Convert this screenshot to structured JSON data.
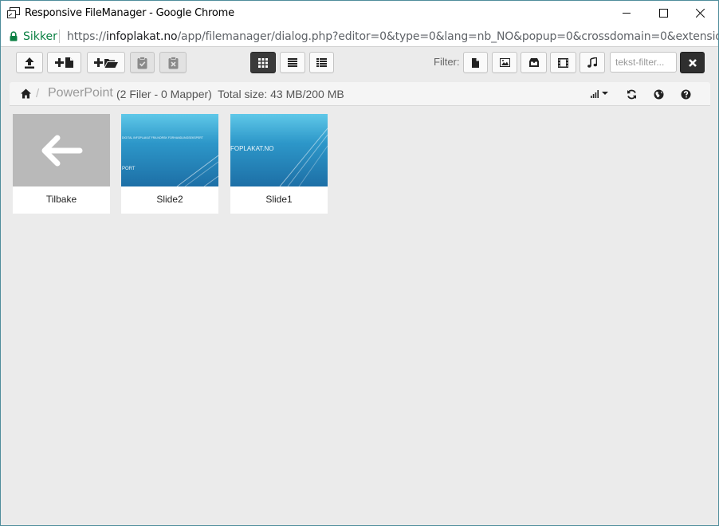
{
  "window": {
    "title": "Responsive FileManager - Google Chrome"
  },
  "address_bar": {
    "secure_label": "Sikker",
    "url_scheme": "https://",
    "url_host": "infoplakat.no",
    "url_path": "/app/filemanager/dialog.php?editor=0&type=0&lang=nb_NO&popup=0&crossdomain=0&extensions=\"\"&field_id"
  },
  "toolbar": {
    "filter_label": "Filter:",
    "text_filter_placeholder": "tekst-filter...",
    "view_mode": "grid",
    "buttons": [
      "upload-icon",
      "new-file-icon",
      "new-folder-icon",
      "paste-icon",
      "clear-clipboard-icon"
    ],
    "views": [
      "grid-view-icon",
      "list-view-icon",
      "columns-view-icon"
    ],
    "filters": [
      "file-filter-icon",
      "image-filter-icon",
      "archive-filter-icon",
      "video-filter-icon",
      "music-filter-icon"
    ]
  },
  "breadcrumb": {
    "separator": "/",
    "folder": "PowerPoint",
    "info": "(2 Filer - 0 Mapper)",
    "total": "Total size: 43 MB/200 MB"
  },
  "items": [
    {
      "label": "Tilbake",
      "kind": "back"
    },
    {
      "label": "Slide2",
      "kind": "image",
      "thumb_line1": "DIGITAL INFOPLAKAT FRA NORSK FORHANDLINGSEKSPERT",
      "thumb_line2": "PORT"
    },
    {
      "label": "Slide1",
      "kind": "image",
      "thumb_line1": "FOPLAKAT.NO"
    }
  ],
  "colors": {
    "secure": "#0b8043",
    "active_view": "#3a3a3a",
    "background": "#ebebeb",
    "slide_gradient_top": "#5fc8e8",
    "slide_gradient_bottom": "#1d6fa6"
  }
}
